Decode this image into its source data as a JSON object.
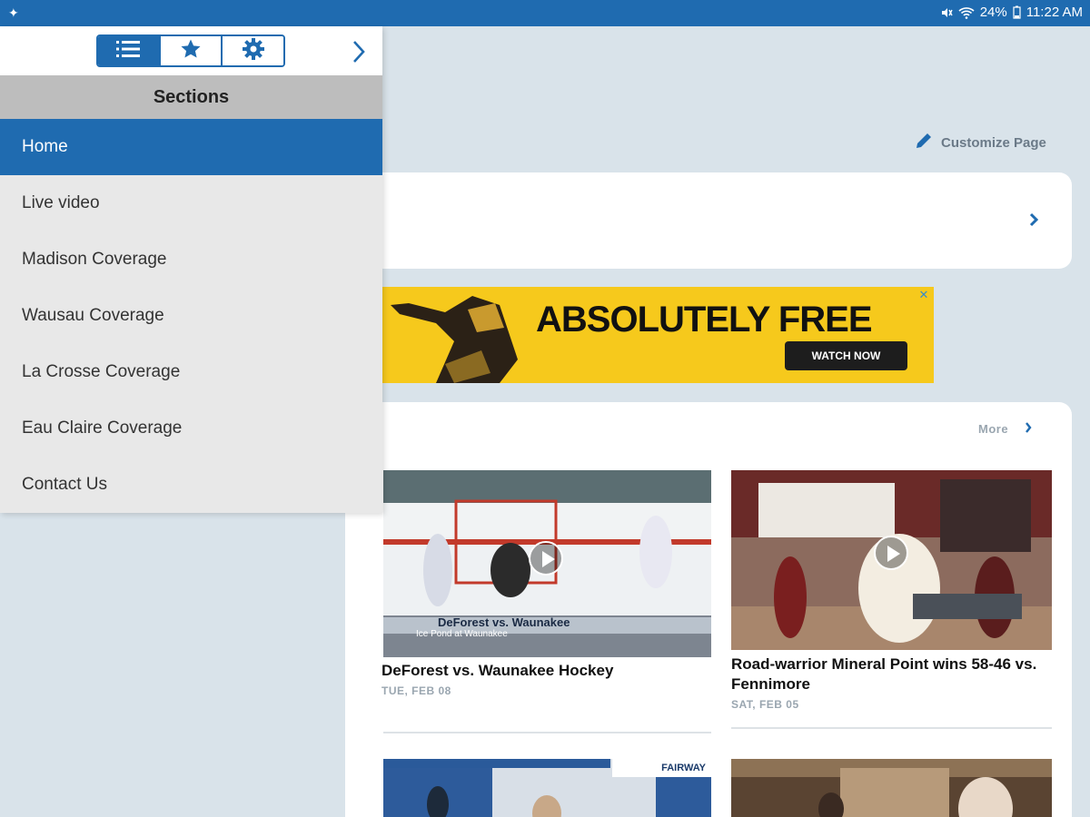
{
  "status_bar": {
    "battery": "24%",
    "time": "11:22 AM"
  },
  "main": {
    "customize_label": "Customize Page",
    "ad": {
      "headline": "ABSOLUTELY FREE",
      "button_label": "WATCH NOW"
    },
    "more_label": "More",
    "stories": [
      {
        "video_caption": "DeForest vs. Waunakee",
        "video_subcaption": "Ice Pond at Waunakee",
        "title": "DeForest vs. Waunakee Hockey",
        "date": "TUE, FEB 08"
      },
      {
        "title": "Road-warrior Mineral Point wins 58-46 vs. Fennimore",
        "date": "SAT, FEB 05"
      }
    ],
    "third_video_sign": "FAIRWAY"
  },
  "drawer": {
    "section_header": "Sections",
    "items": [
      {
        "label": "Home",
        "active": true
      },
      {
        "label": "Live video",
        "active": false
      },
      {
        "label": "Madison Coverage",
        "active": false
      },
      {
        "label": "Wausau Coverage",
        "active": false
      },
      {
        "label": "La Crosse Coverage",
        "active": false
      },
      {
        "label": "Eau Claire Coverage",
        "active": false
      },
      {
        "label": "Contact Us",
        "active": false
      }
    ]
  },
  "colors": {
    "brand": "#1f6bb0",
    "ad_yellow": "#f6c91c",
    "page_bg": "#d9e3ea"
  }
}
